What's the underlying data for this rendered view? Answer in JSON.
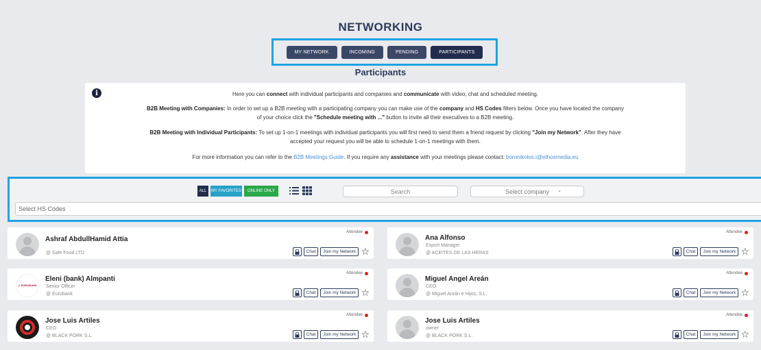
{
  "header": {
    "title": "NETWORKING",
    "subtitle": "Participants"
  },
  "tabs": [
    {
      "label": "MY NETWORK",
      "active": false
    },
    {
      "label": "INCOMING",
      "active": false
    },
    {
      "label": "PENDING",
      "active": false
    },
    {
      "label": "PARTICIPANTS",
      "active": true
    }
  ],
  "info": {
    "line1_pre": "Here you can ",
    "line1_b1": "connect",
    "line1_mid": " with individual participants and companies and ",
    "line1_b2": "communicate",
    "line1_post": " with video, chat and scheduled meeting.",
    "line2_b": "B2B Meeting with Companies:",
    "line2_a": " In order to set up a B2B meeting with a participating company you can make use of the ",
    "line2_b2": "company",
    "line2_c": " and ",
    "line2_b3": "HS Codes",
    "line2_d": " filters below. Once you have located the company",
    "line3_a": "of your choice click the ",
    "line3_b": "\"Schedule meeting with ...\"",
    "line3_c": " button to invite all their executives to a B2B meeting.",
    "line4_b": "B2B Meeting with Individual Participants:",
    "line4_a": " To set up 1-on-1 meetings with individual participants you will first need to send them a friend request by clicking ",
    "line4_b2": "\"Join my Network\"",
    "line4_c": ". After they have",
    "line5": "accepted your request you will be able to schedule 1-on-1 meetings with them.",
    "line6_a": "For more information you can refer to the ",
    "line6_link": "B2B Meetings Guide",
    "line6_b": ". If you require any ",
    "line6_bold": "assistance",
    "line6_c": " with your meetings please contact: ",
    "line6_email": "boronikolos.i@ethosmedia.eu"
  },
  "filters": {
    "all_label": "ALL",
    "favorites_label": "MY FAVORITES",
    "online_label": "ONLINE ONLY",
    "search_placeholder": "Search",
    "company_select": "Select company",
    "hs_placeholder": "Select HS Codes"
  },
  "colors": {
    "accent_border": "#1fa3e3",
    "tab_bg": "#3b4766",
    "online_green": "#2ba84a",
    "favorites_blue": "#27a0c8",
    "status_dot": "#e02020"
  },
  "participants": [
    {
      "name": "Ashraf AbdullHamid Attia",
      "role": "",
      "company": "@ Safe Food LTD",
      "badge": "Attendee",
      "avatar": "default"
    },
    {
      "name": "Ana Alfonso",
      "role": "Export Manager",
      "company": "@ ACEITES DE LAS HERAS",
      "badge": "Attendee",
      "avatar": "default"
    },
    {
      "name": "Eleni (bank) Almpanti",
      "role": "Senior Officer",
      "company": "@ Eurobank",
      "badge": "Attendee",
      "avatar": "eurobank",
      "logo_text": "◎ EUROBANK"
    },
    {
      "name": "Miguel Angel Areán",
      "role": "CEO",
      "company": "@ Miguel Areán e Hijos, S.L.",
      "badge": "Attendee",
      "avatar": "default"
    },
    {
      "name": "Jose Luis Artiles",
      "role": "CEO",
      "company": "@ BLACK PORK S.L.",
      "badge": "Attendee",
      "avatar": "pork"
    },
    {
      "name": "Jose Luis Artiles",
      "role": "owner",
      "company": "@ BLACK PORK S.L.",
      "badge": "Attendee",
      "avatar": "default"
    }
  ],
  "card_actions": {
    "chat_label": "Chat",
    "join_label": "Join my Network"
  }
}
